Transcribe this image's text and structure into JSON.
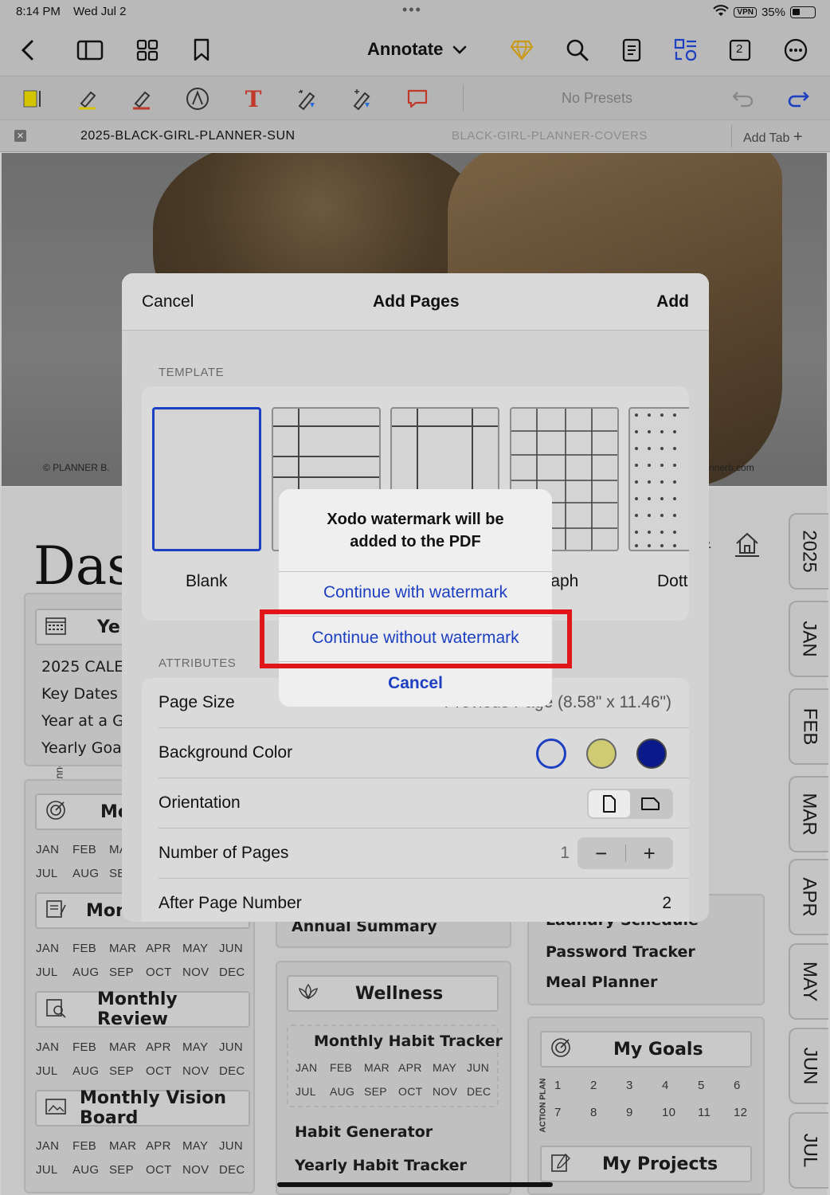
{
  "status": {
    "time": "8:14 PM",
    "date": "Wed Jul 2",
    "vpn": "VPN",
    "battery": "35%"
  },
  "nav": {
    "mode_label": "Annotate",
    "page_count_badge": "2"
  },
  "toolbar": {
    "presets_label": "No Presets"
  },
  "tabs": {
    "active": "2025-BLACK-GIRL-PLANNER-SUN",
    "inactive": "BLACK-GIRL-PLANNER-COVERS",
    "add_tab": "Add Tab"
  },
  "document": {
    "copyright_left": "© PLANNER B.",
    "copyright_right": "nnerb.com",
    "vertical_credit": "© Planner B. | digitalplannerb.com",
    "dash_title": "Das",
    "year_card_title": "Ye",
    "year_items": [
      "2025 CALE",
      "Key Dates",
      "Year at a Gl",
      "Yearly Goal"
    ],
    "card_mo_title": "Mo",
    "card_mont_title": "Mont",
    "months_row1_short": [
      "JAN",
      "FEB",
      "MA"
    ],
    "months_row2_short": [
      "JUL",
      "AUG",
      "SE"
    ],
    "monthly_review": "Monthly Review",
    "monthly_vision_board": "Monthly Vision Board",
    "months_row1": [
      "JAN",
      "FEB",
      "MAR",
      "APR",
      "MAY",
      "JUN"
    ],
    "months_row2": [
      "JUL",
      "AUG",
      "SEP",
      "OCT",
      "NOV",
      "DEC"
    ],
    "annual_summary": "Annual Summary",
    "wellness": "Wellness",
    "monthly_habit_tracker": "Monthly Habit Tracker",
    "habit_generator": "Habit Generator",
    "yearly_habit_tracker": "Yearly Habit Tracker",
    "laundry_schedule": "Laundry Schedule",
    "password_tracker": "Password Tracker",
    "meal_planner": "Meal Planner",
    "my_goals": "My Goals",
    "action_plan": "ACTION PLAN",
    "goal_numbers_row1": [
      "1",
      "2",
      "3",
      "4",
      "5",
      "6"
    ],
    "goal_numbers_row2": [
      "7",
      "8",
      "9",
      "10",
      "11",
      "12"
    ],
    "my_projects": "My Projects",
    "side_tabs": [
      "2025",
      "JAN",
      "FEB",
      "MAR",
      "APR",
      "MAY",
      "JUN",
      "JUL"
    ]
  },
  "sheet": {
    "cancel": "Cancel",
    "title": "Add Pages",
    "add": "Add",
    "template_label": "TEMPLATE",
    "templates": [
      "Blank",
      "Graph",
      "Dott"
    ],
    "attributes_label": "ATTRIBUTES",
    "page_size_label": "Page Size",
    "page_size_value": "Previous Page (8.58\" x 11.46\")",
    "background_color_label": "Background Color",
    "orientation_label": "Orientation",
    "number_of_pages_label": "Number of Pages",
    "number_of_pages_value": "1",
    "after_page_label": "After Page Number",
    "after_page_value": "2",
    "colors": [
      "#ffffff",
      "#f3f08c",
      "#0a1a8a"
    ]
  },
  "alert": {
    "message": "Xodo watermark will be added to the PDF",
    "with_watermark": "Continue with watermark",
    "without_watermark": "Continue without watermark",
    "cancel": "Cancel"
  },
  "accent": "#1d3fc1",
  "highlight_color": "#e0161b"
}
